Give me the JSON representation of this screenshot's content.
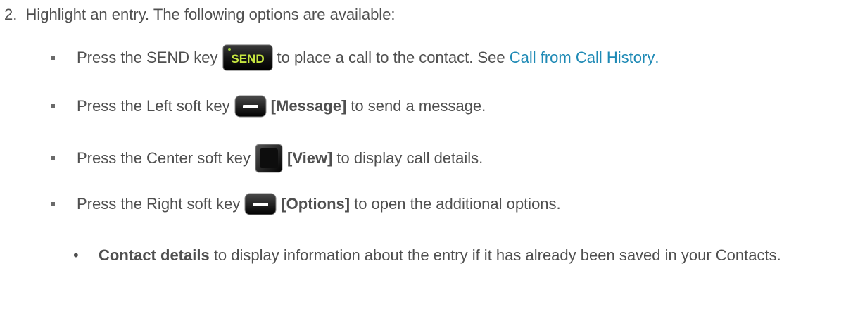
{
  "step": {
    "number": "2.",
    "text": "Highlight an entry. The following options are available:"
  },
  "bullets": [
    {
      "before": "Press the SEND key",
      "key_icon": "send-key-icon",
      "key_label": "SEND",
      "after": "to place a call to the contact. See ",
      "link": "Call from Call History",
      "tail": "."
    },
    {
      "before": "Press the Left soft key",
      "key_icon": "left-soft-key-icon",
      "bold": "[Message]",
      "after": "to send a message."
    },
    {
      "before": "Press the Center soft key",
      "key_icon": "center-soft-key-icon",
      "bold": "[View]",
      "after": "to display call details."
    },
    {
      "before": "Press the Right soft key",
      "key_icon": "right-soft-key-icon",
      "bold": "[Options]",
      "after": "to open the additional options."
    }
  ],
  "sub_items": [
    {
      "bullet": "•",
      "bold": "Contact details",
      "text": " to display information about the entry if it has already been saved in your Contacts."
    }
  ],
  "colors": {
    "text": "#4f4f4f",
    "link": "#1f8ab5",
    "send_key_text": "#c6e640",
    "key_body": "#1a1a1a"
  }
}
